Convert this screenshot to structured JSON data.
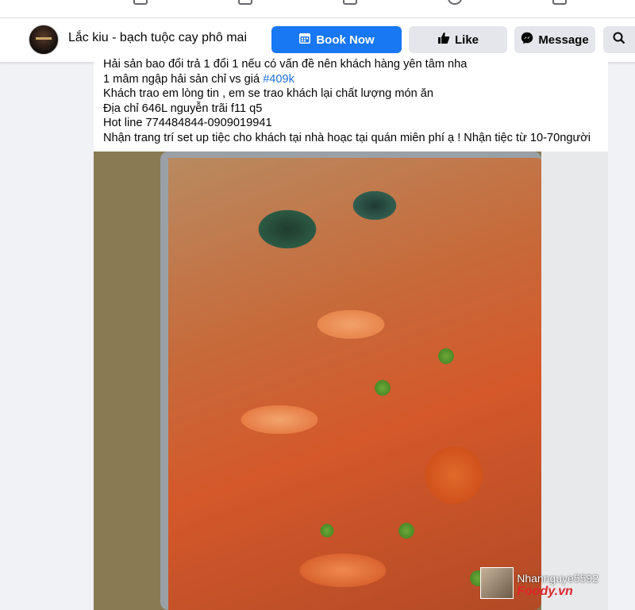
{
  "page": {
    "name": "Lắc kiu - bạch tuộc cay phô mai",
    "buttons": {
      "book": "Book Now",
      "like": "Like",
      "message": "Message"
    },
    "icons": {
      "book": "calendar-icon",
      "like": "thumbs-up-icon",
      "message": "messenger-icon",
      "search": "search-icon"
    },
    "accent_color": "#1877f2"
  },
  "post": {
    "lines": [
      "Hải sản bao đổi trả 1 đổi 1 nếu có vấn đề nên khách hàng yên tâm nha",
      "1 mâm ngập hải sản chỉ vs giá ",
      "Khách trao em lòng tin , em se trao khách lại chất lượng món ăn",
      "Địa chỉ 646L nguyễn trãi f11 q5",
      "Hot line 774484844-0909019941",
      "Nhận trang trí set up tiệc cho khách tại nhà hoạc tại quán miên phí ạ ! Nhận tiệc từ 10-70người"
    ],
    "hashtag": "#409k"
  },
  "photo": {
    "watermark_user": "Nhannguye5592",
    "watermark_logo": "Foody.vn"
  }
}
